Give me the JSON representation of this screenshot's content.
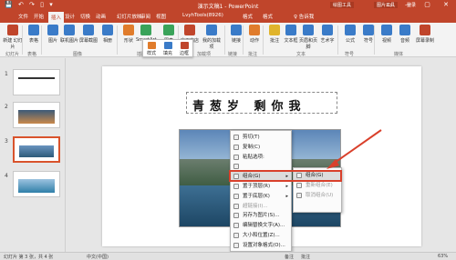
{
  "titlebar": {
    "quick_access": "💾 ↶ ↷ ▯ ▾",
    "title": "演示文稿1 - PowerPoint",
    "tools_a": "绘图工具",
    "tools_b": "图片工具",
    "login": "登录",
    "window_controls": "▭ — ▢ ✕"
  },
  "tabs": [
    "文件",
    "开始",
    "插入",
    "设计",
    "切换",
    "动画",
    "幻灯片放映",
    "审阅",
    "视图",
    "LvyhTools(8926)",
    "格式",
    "格式",
    "♀ 告诉我"
  ],
  "ribbon": {
    "buttons": [
      {
        "label": "新建\n幻灯片",
        "color": "#c0452b"
      },
      {
        "label": "表格",
        "color": "#3a7bc8"
      },
      {
        "label": "图片",
        "color": "#3a7bc8"
      },
      {
        "label": "联机图片",
        "color": "#3a7bc8"
      },
      {
        "label": "屏幕截图",
        "color": "#3a7bc8"
      },
      {
        "label": "相册",
        "color": "#3a7bc8"
      },
      {
        "label": "形状",
        "color": "#e07c2c"
      },
      {
        "label": "SmartArt",
        "color": "#3aa35a"
      },
      {
        "label": "图表",
        "color": "#3aa35a"
      },
      {
        "label": "应用商店",
        "color": "#c0452b"
      },
      {
        "label": "我的加载项",
        "color": "#3a7bc8"
      },
      {
        "label": "链接",
        "color": "#3a7bc8"
      },
      {
        "label": "动作",
        "color": "#e07c2c"
      },
      {
        "label": "批注",
        "color": "#e0b42c"
      },
      {
        "label": "文本框",
        "color": "#3a7bc8"
      },
      {
        "label": "页眉和页脚",
        "color": "#3a7bc8"
      },
      {
        "label": "艺术字",
        "color": "#3a7bc8"
      },
      {
        "label": "公式",
        "color": "#3a7bc8"
      },
      {
        "label": "符号",
        "color": "#3a7bc8"
      },
      {
        "label": "视频",
        "color": "#3a7bc8"
      },
      {
        "label": "音频",
        "color": "#3a7bc8"
      },
      {
        "label": "屏幕录制",
        "color": "#c0452b"
      }
    ],
    "groups": [
      "幻灯片",
      "表格",
      "图像",
      "插图",
      "加载项",
      "链接",
      "批注",
      "文本",
      "符号",
      "媒体"
    ]
  },
  "slides": [
    {
      "num": "1"
    },
    {
      "num": "2"
    },
    {
      "num": "3"
    },
    {
      "num": "4"
    }
  ],
  "slide": {
    "caption": "青葱岁  剩你我"
  },
  "minibar": {
    "style": "样式",
    "fill": "填充",
    "border": "边框"
  },
  "context_menu": [
    {
      "label": "剪切(T)",
      "disabled": false
    },
    {
      "label": "复制(C)",
      "disabled": false
    },
    {
      "label": "粘贴选项:",
      "disabled": false
    },
    {
      "label": "",
      "disabled": false
    },
    {
      "label": "组合(G)",
      "disabled": false,
      "submenu": true
    },
    {
      "label": "置于顶层(R)",
      "disabled": false,
      "submenu": true
    },
    {
      "label": "置于底层(K)",
      "disabled": false,
      "submenu": true
    },
    {
      "label": "超链接(I)...",
      "disabled": true
    },
    {
      "label": "另存为图片(S)...",
      "disabled": false
    },
    {
      "label": "编辑替换文字(A)...",
      "disabled": false
    },
    {
      "label": "大小和位置(Z)...",
      "disabled": false
    },
    {
      "label": "设置对象格式(O)...",
      "disabled": false
    }
  ],
  "submenu": [
    {
      "label": "组合(G)",
      "disabled": false
    },
    {
      "label": "重新组合(E)",
      "disabled": true
    },
    {
      "label": "取消组合(U)",
      "disabled": true
    }
  ],
  "status": {
    "slide_info": "幻灯片 第 3 张，共 4 张",
    "lang": "中文(中国)",
    "notes": "备注",
    "comments": "批注",
    "zoom": "63%"
  },
  "colors": {
    "accent": "#c0452b",
    "highlight": "#d9402b"
  }
}
